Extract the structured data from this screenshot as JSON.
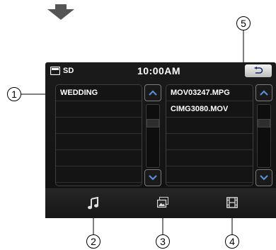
{
  "status_bar": {
    "storage_label": "SD",
    "time": "10:00AM"
  },
  "left_list": {
    "items": [
      "WEDDING",
      "",
      "",
      "",
      "",
      ""
    ]
  },
  "right_list": {
    "items": [
      "MOV03247.MPG",
      "CIMG3080.MOV",
      "",
      "",
      "",
      ""
    ]
  },
  "callouts": [
    "1",
    "2",
    "3",
    "4",
    "5"
  ],
  "colors": {
    "screen_bg": "#141414",
    "text": "#ffffff",
    "accent": "#5a8fd6"
  },
  "icons": [
    "arrow-down-icon",
    "sd-card-icon",
    "back-icon",
    "music-icon",
    "photo-icon",
    "film-icon",
    "chevron-up-icon",
    "chevron-down-icon"
  ]
}
